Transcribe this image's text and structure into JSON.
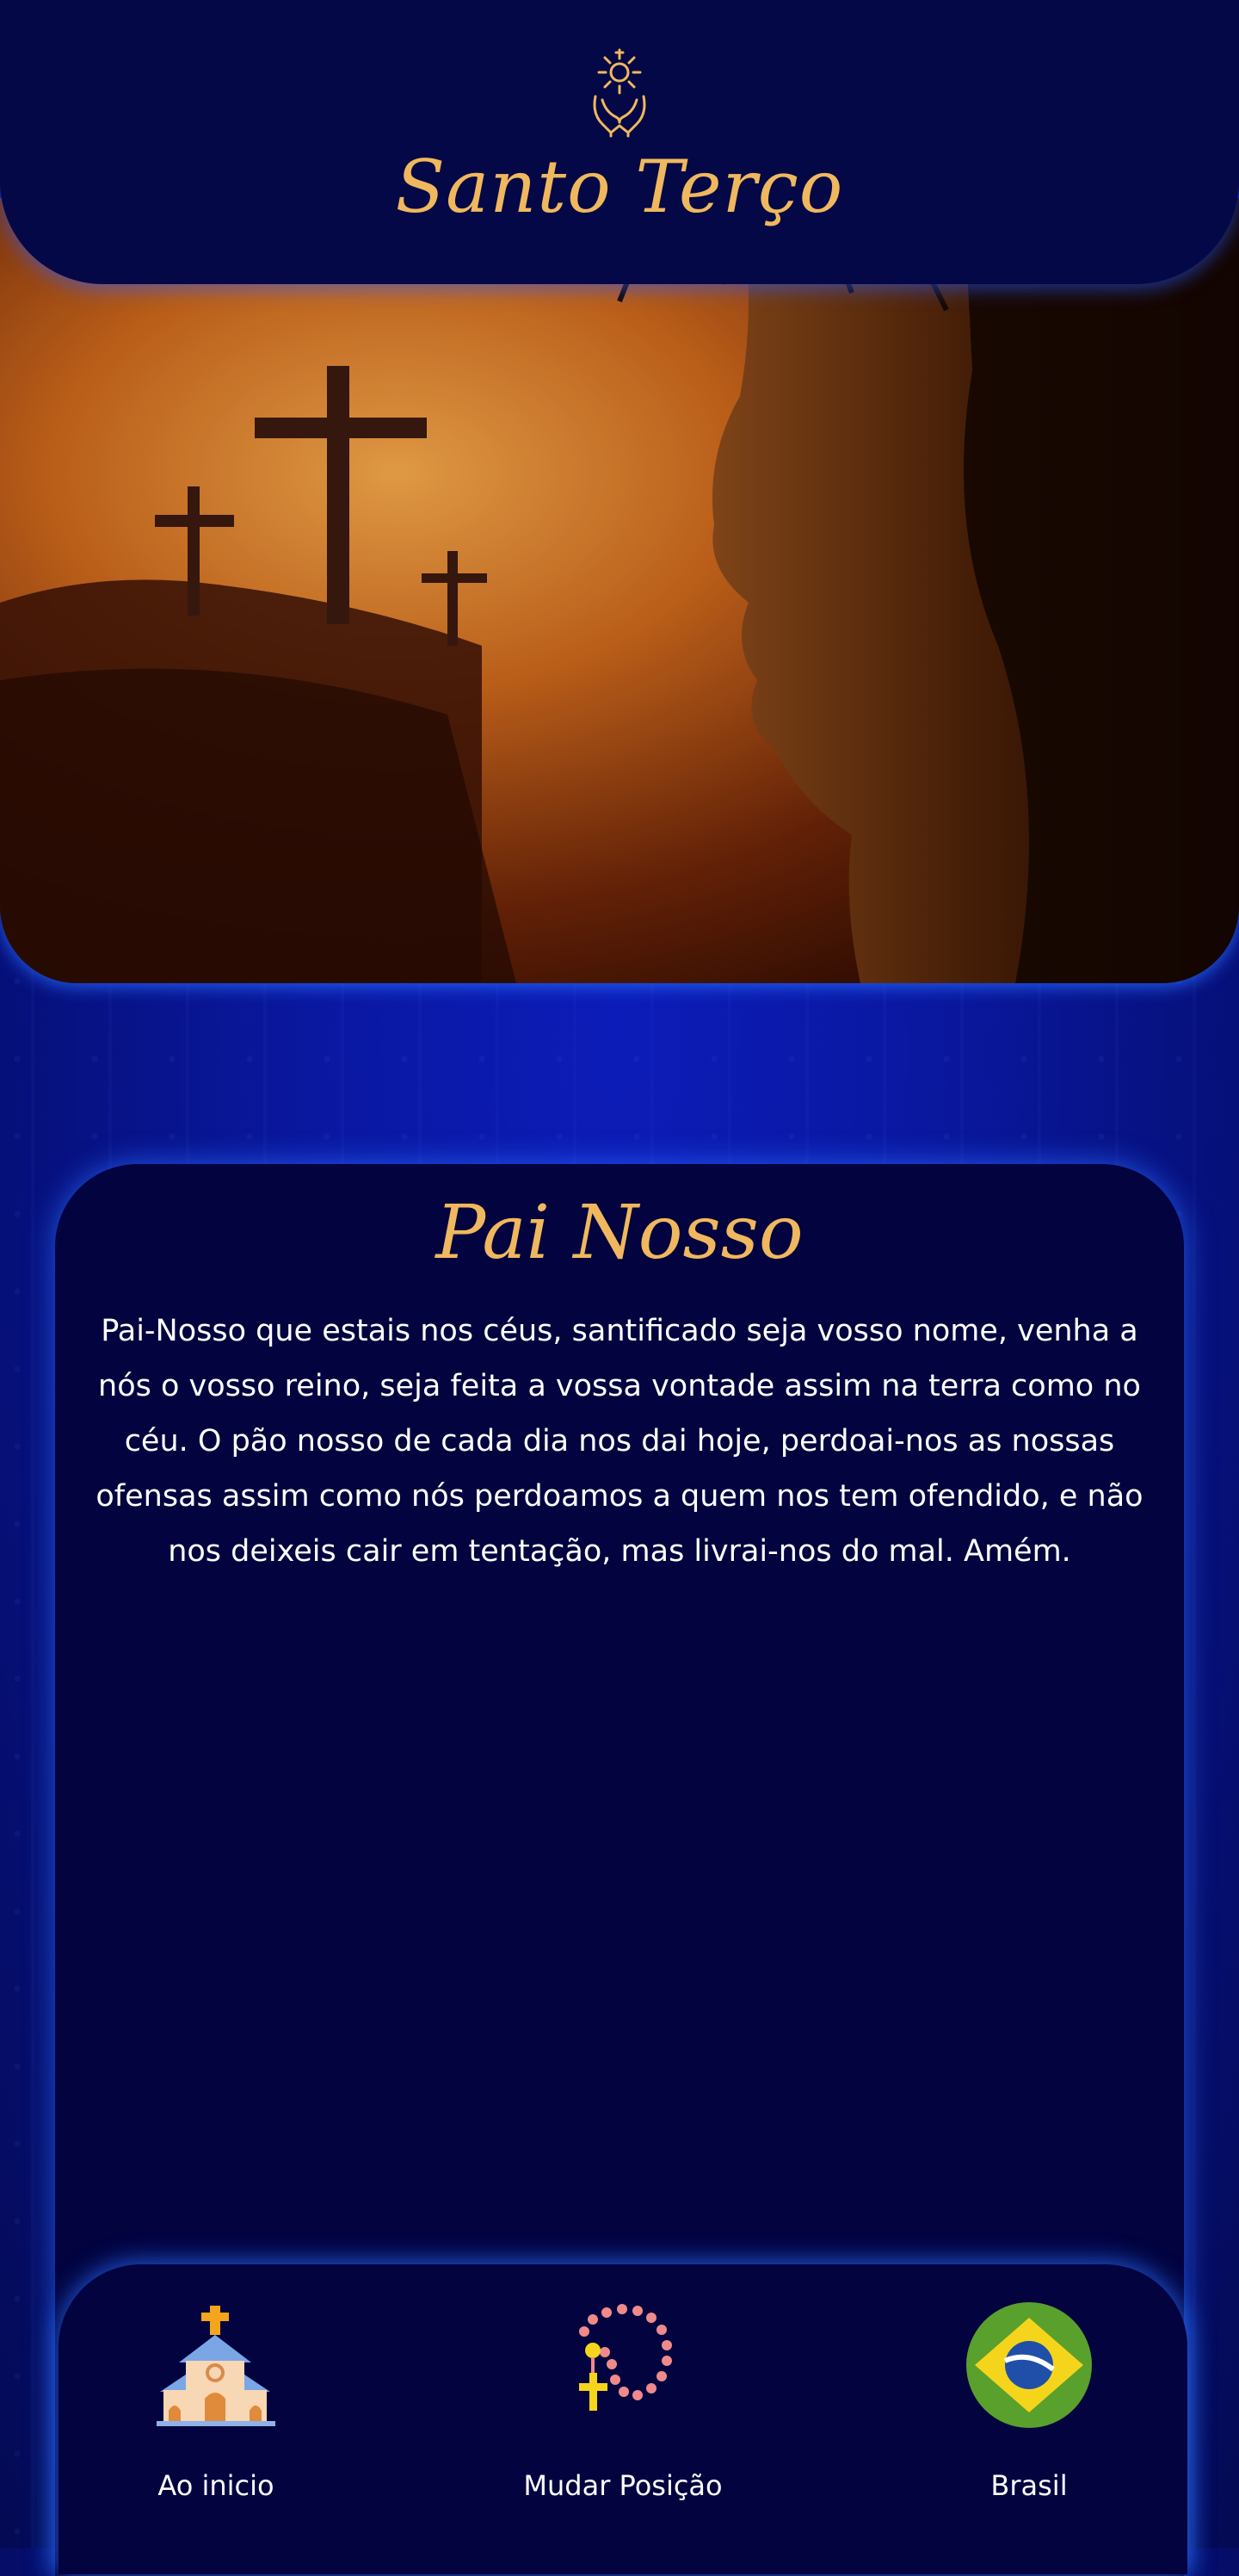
{
  "header": {
    "title": "Santo Terço",
    "logo_icon": "praying-hands-monstrance-icon"
  },
  "hero": {
    "image_description_icon": "crucifixion-hero-image"
  },
  "prayer": {
    "title": "Pai Nosso",
    "text": "Pai-Nosso que estais nos céus, santificado seja vosso nome, venha a nós o vosso reino, seja feita a vossa vontade assim na terra como no céu. O pão nosso de cada dia nos dai hoje, perdoai-nos as nossas ofensas assim como nós perdoamos a quem nos tem ofendido, e não nos deixeis cair em tentação, mas livrai-nos do mal. Amém."
  },
  "nav": {
    "items": [
      {
        "label": "Ao inicio",
        "icon": "church-icon"
      },
      {
        "label": "Mudar Posição",
        "icon": "rosary-icon"
      },
      {
        "label": "Brasil",
        "icon": "brazil-flag-icon"
      }
    ]
  },
  "colors": {
    "accent_gold": "#f0b85e",
    "card_bg": "#02033f",
    "page_blue": "#0a18a0",
    "glow": "#2a6eff"
  }
}
